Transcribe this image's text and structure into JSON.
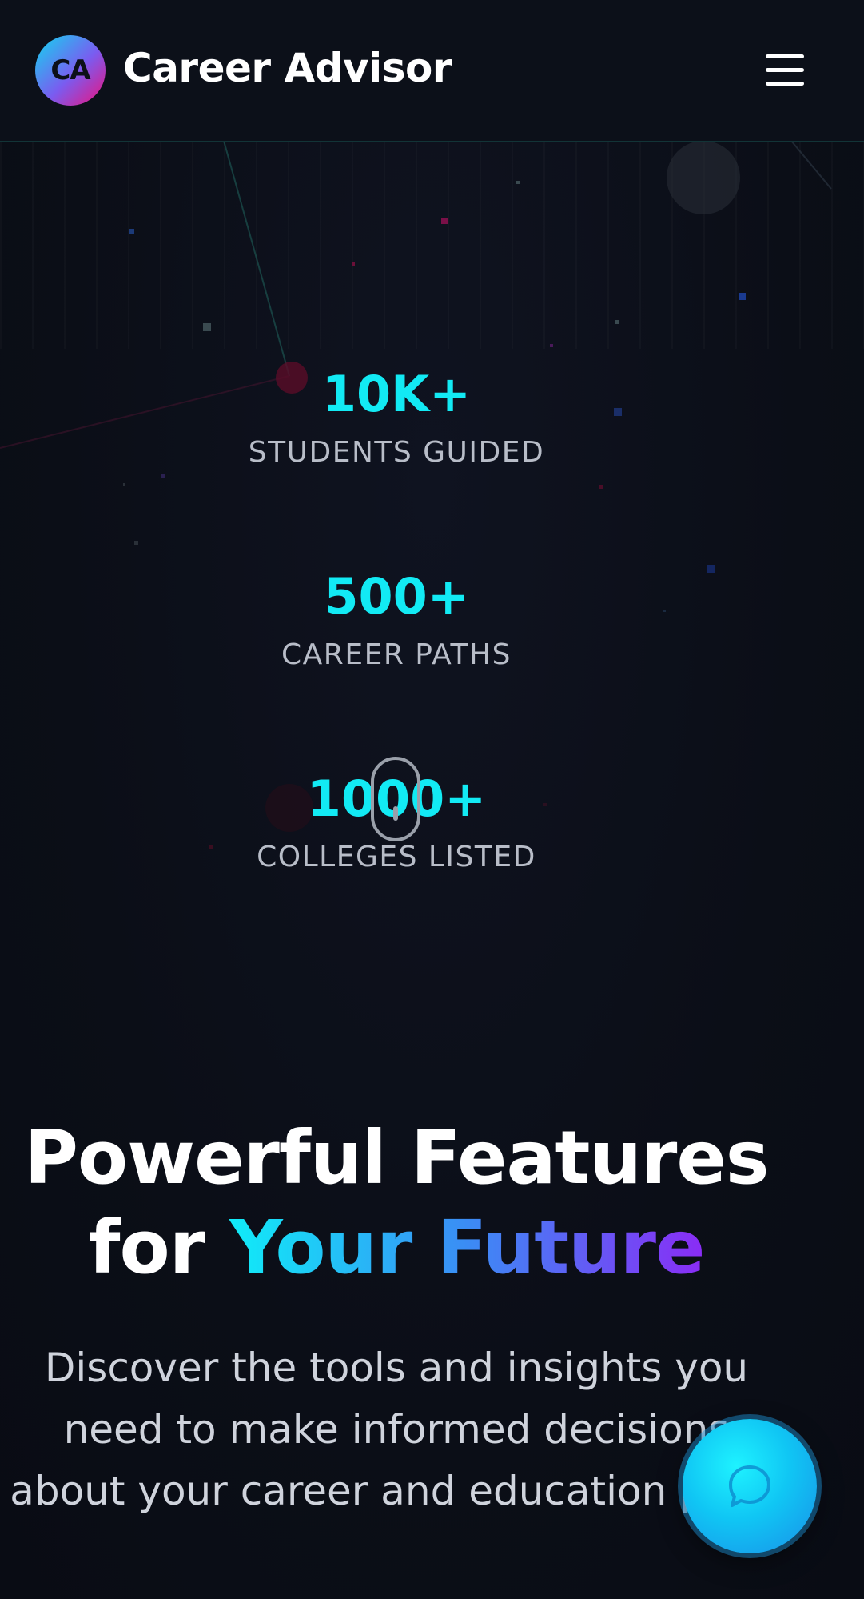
{
  "header": {
    "logo_text": "CA",
    "brand": "Career Advisor",
    "menu_icon": "hamburger-menu-icon"
  },
  "stats": [
    {
      "value": "10K+",
      "label": "STUDENTS GUIDED"
    },
    {
      "value": "500+",
      "label": "CAREER PATHS"
    },
    {
      "value": "1000+",
      "label": "COLLEGES LISTED"
    }
  ],
  "scroll_indicator_icon": "mouse-scroll-icon",
  "features": {
    "title_line1": "Powerful Features",
    "title_for": "for ",
    "title_highlight": "Your Future",
    "description": "Discover the tools and insights you need to make informed decisions about your career and education path."
  },
  "chat_fab": {
    "icon": "chat-bubble-icon"
  },
  "colors": {
    "background": "#0b0e17",
    "accent_cyan": "#12eaf4",
    "gradient_start": "#10ecf8",
    "gradient_mid": "#3b8cf5",
    "gradient_end": "#8a2cf5",
    "logo_pink": "#f0107a"
  }
}
